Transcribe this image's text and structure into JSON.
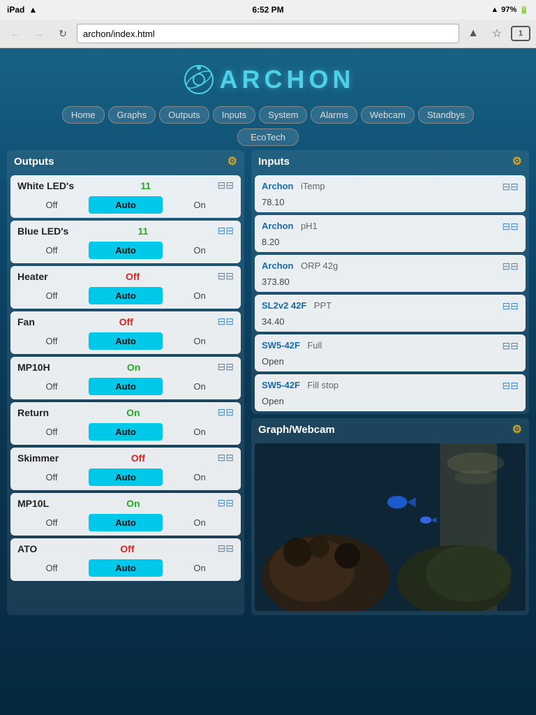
{
  "statusBar": {
    "carrier": "iPad",
    "wifi": "WiFi",
    "time": "6:52 PM",
    "signal": "↑",
    "battery": "97%"
  },
  "browser": {
    "backDisabled": true,
    "forwardDisabled": true,
    "addressUrl": "archon/index.html",
    "tabCount": "1"
  },
  "logo": {
    "text": "ARCHON"
  },
  "nav": {
    "items": [
      "Home",
      "Graphs",
      "Outputs",
      "Inputs",
      "System",
      "Alarms",
      "Webcam",
      "Standbys"
    ],
    "extra": "EcoTech"
  },
  "outputs": {
    "title": "Outputs",
    "items": [
      {
        "name": "White LED's",
        "value": "11",
        "valueType": "green",
        "controls": [
          "Off",
          "Auto",
          "On"
        ]
      },
      {
        "name": "Blue LED's",
        "value": "11",
        "valueType": "green",
        "controls": [
          "Off",
          "Auto",
          "On"
        ]
      },
      {
        "name": "Heater",
        "value": "Off",
        "valueType": "red",
        "controls": [
          "Off",
          "Auto",
          "On"
        ]
      },
      {
        "name": "Fan",
        "value": "Off",
        "valueType": "red",
        "controls": [
          "Off",
          "Auto",
          "On"
        ]
      },
      {
        "name": "MP10H",
        "value": "On",
        "valueType": "green",
        "controls": [
          "Off",
          "Auto",
          "On"
        ]
      },
      {
        "name": "Return",
        "value": "On",
        "valueType": "green",
        "controls": [
          "Off",
          "Auto",
          "On"
        ]
      },
      {
        "name": "Skimmer",
        "value": "Off",
        "valueType": "red",
        "controls": [
          "Off",
          "Auto",
          "On"
        ]
      },
      {
        "name": "MP10L",
        "value": "On",
        "valueType": "green",
        "controls": [
          "Off",
          "Auto",
          "On"
        ]
      },
      {
        "name": "ATO",
        "value": "Off",
        "valueType": "red",
        "controls": [
          "Off",
          "Auto",
          "On"
        ]
      }
    ],
    "activeControl": "Auto"
  },
  "inputs": {
    "title": "Inputs",
    "items": [
      {
        "source": "Archon",
        "label": "iTemp",
        "value": "78.10"
      },
      {
        "source": "Archon",
        "label": "pH1",
        "value": "8.20"
      },
      {
        "source": "Archon",
        "label": "ORP 42g",
        "value": "373.80"
      },
      {
        "source": "SL2v2 42F",
        "label": "PPT",
        "value": "34.40"
      },
      {
        "source": "SW5-42F",
        "label": "Full",
        "value": "Open"
      },
      {
        "source": "SW5-42F",
        "label": "Fill stop",
        "value": "Open"
      }
    ]
  },
  "graphWebcam": {
    "title": "Graph/Webcam"
  },
  "icons": {
    "gear": "⚙",
    "sliders": "⊞",
    "back": "←",
    "forward": "→",
    "reload": "↻",
    "share": "↑",
    "star": "☆",
    "wifi": "📶"
  }
}
